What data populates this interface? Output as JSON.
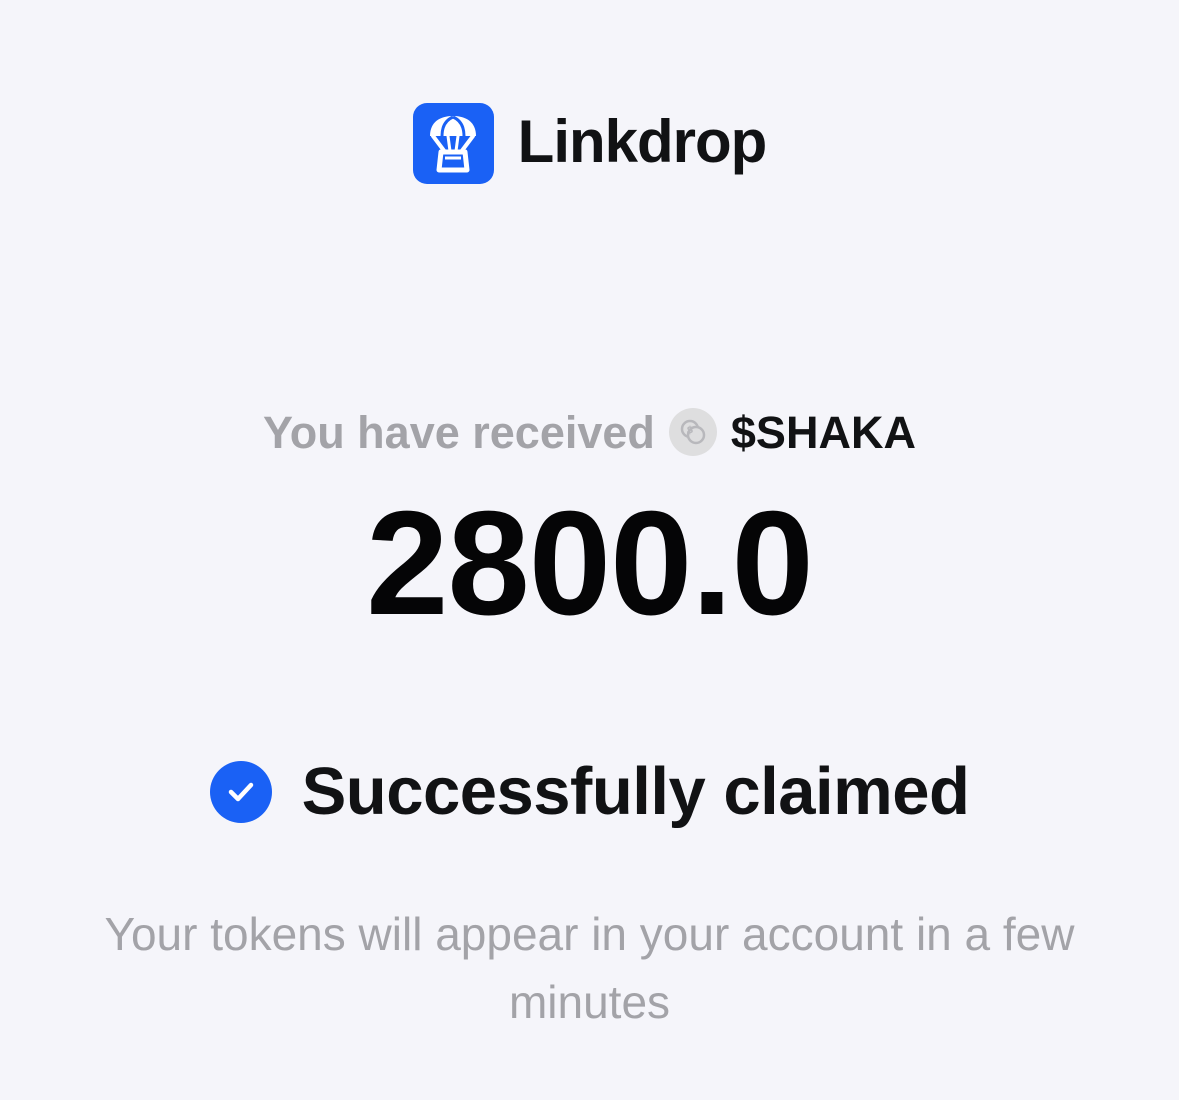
{
  "brand": {
    "name": "Linkdrop",
    "logo_icon": "parachute-icon",
    "accent": "#1a61f5"
  },
  "claim": {
    "received_label": "You have received",
    "token_icon": "coin-icon",
    "token_symbol": "$SHAKA",
    "amount": "2800.0"
  },
  "status": {
    "icon": "checkmark-circle-icon",
    "text": "Successfully claimed",
    "color": "#1a61f5"
  },
  "note": {
    "text": "Your tokens will appear in your account in a few minutes"
  },
  "colors": {
    "background": "#f5f5fa",
    "muted_text": "#a3a3a8",
    "primary_text": "#111214"
  }
}
